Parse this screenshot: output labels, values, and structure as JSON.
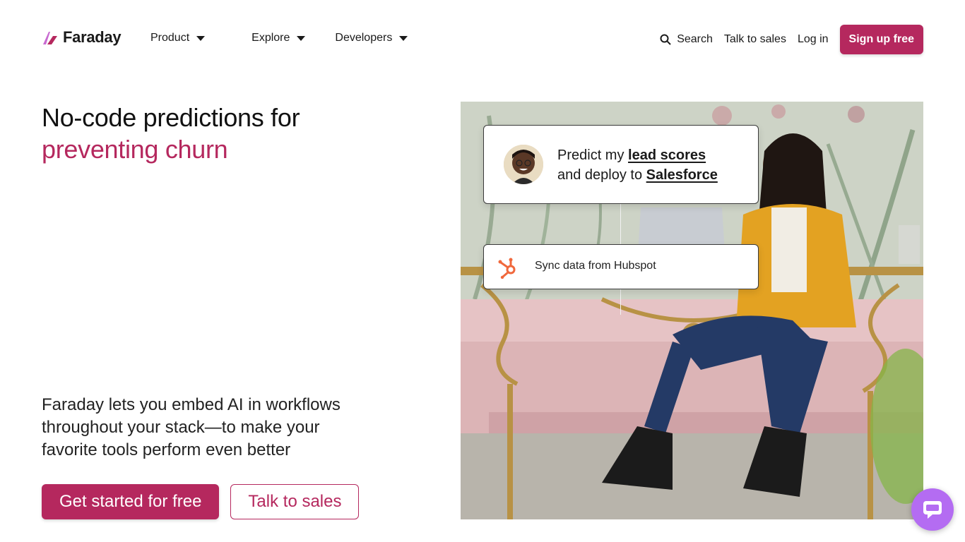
{
  "brand": {
    "name": "Faraday",
    "accent_color": "#b5285e",
    "chat_color": "#b46cf2"
  },
  "nav": {
    "menu": [
      {
        "label": "Product"
      },
      {
        "label": "Explore"
      },
      {
        "label": "Developers"
      }
    ],
    "search_label": "Search",
    "talk_to_sales": "Talk to sales",
    "login": "Log in",
    "signup": "Sign up free"
  },
  "hero": {
    "headline_line1": "No-code predictions for",
    "headline_line2": "preventing churn",
    "lede": "Faraday lets you embed AI in workflows throughout your stack—to make your favorite tools perform even better",
    "cta_primary": "Get started for free",
    "cta_secondary": "Talk to sales"
  },
  "card_top": {
    "prefix1": "Predict my ",
    "link1": "lead scores",
    "prefix2": "and deploy to ",
    "link2": "Salesforce"
  },
  "card_bottom": {
    "text": "Sync data from Hubspot",
    "icon": "hubspot-icon"
  },
  "chat": {
    "icon": "chat-bubble-icon"
  }
}
